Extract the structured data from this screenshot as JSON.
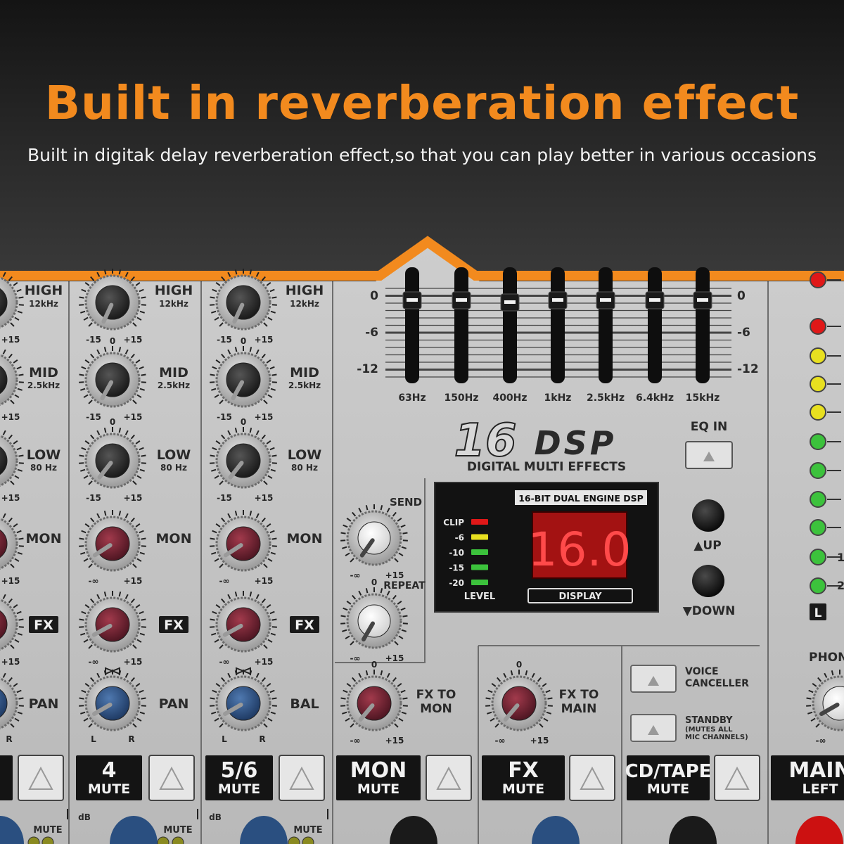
{
  "header": {
    "title": "Built in reverberation effect",
    "subtitle": "Built in digitak delay reverberation effect,so that you can play better in various occasions",
    "accent": "#f28a1e"
  },
  "channels": [
    {
      "id": "ch3",
      "labels": [
        "HIGH",
        "12kHz",
        "MID",
        "2.5kHz",
        "LOW",
        "80 Hz",
        "MON",
        "FX",
        "PAN"
      ],
      "name": "",
      "mute": ""
    },
    {
      "id": "ch4",
      "labels": [
        "HIGH",
        "12kHz",
        "MID",
        "2.5kHz",
        "LOW",
        "80 Hz",
        "MON",
        "FX",
        "PAN"
      ],
      "name": "4",
      "mute": "MUTE"
    },
    {
      "id": "ch56",
      "labels": [
        "HIGH",
        "12kHz",
        "MID",
        "2.5kHz",
        "LOW",
        "80 Hz",
        "MON",
        "FX",
        "BAL"
      ],
      "name": "5/6",
      "mute": "MUTE"
    }
  ],
  "knob_scale": {
    "min": "-15",
    "max": "+15",
    "center": "0",
    "inf": "-∞",
    "l": "L",
    "r": "R"
  },
  "eq": {
    "bands": [
      "63Hz",
      "150Hz",
      "400Hz",
      "1kHz",
      "2.5kHz",
      "6.4kHz",
      "15kHz"
    ],
    "scale": [
      "0",
      "-6",
      "-12"
    ],
    "eq_in_label": "EQ IN"
  },
  "dsp": {
    "logo_number": "16",
    "logo_text": "DSP",
    "subtitle": "DIGITAL MULTI EFFECTS",
    "screen_title": "16-BIT DUAL ENGINE DSP",
    "display_value": "16.0",
    "display_label": "DISPLAY",
    "meter_labels": [
      "CLIP",
      "-6",
      "-10",
      "-15",
      "-20"
    ],
    "meter_footer": "LEVEL",
    "send_label": "SEND",
    "repeat_label": "REPEAT",
    "up_label": "▲UP",
    "down_label": "▼DOWN"
  },
  "fx_knobs": {
    "fx_to_mon": [
      "FX TO",
      "MON"
    ],
    "fx_to_main": [
      "FX TO",
      "MAIN"
    ]
  },
  "switches": {
    "voice": [
      "VOICE",
      "CANCELLER"
    ],
    "standby": [
      "STANDBY",
      "(MUTES ALL",
      "MIC CHANNELS)"
    ]
  },
  "master_strip": [
    {
      "id": "mon",
      "name": "MON",
      "mute": "MUTE"
    },
    {
      "id": "fx",
      "name": "FX",
      "mute": "MUTE"
    },
    {
      "id": "cdtape",
      "name": "CD/TAPE",
      "mute": "MUTE"
    },
    {
      "id": "main",
      "name": "MAIN",
      "mute": "LEFT"
    }
  ],
  "bottom_labels": {
    "mute": "MUTE",
    "db": "dB"
  },
  "phones_label": "PHON",
  "meter_side_label": "L",
  "meter_numbers": [
    "1",
    "2"
  ],
  "colors": {
    "panel": "#c9c9c9",
    "knob_black": "#2a2a2a",
    "knob_red": "#7a2232",
    "knob_blue": "#2f5486",
    "led_red": "#e01818",
    "led_yellow": "#e8e020",
    "led_green": "#3cc23c"
  }
}
